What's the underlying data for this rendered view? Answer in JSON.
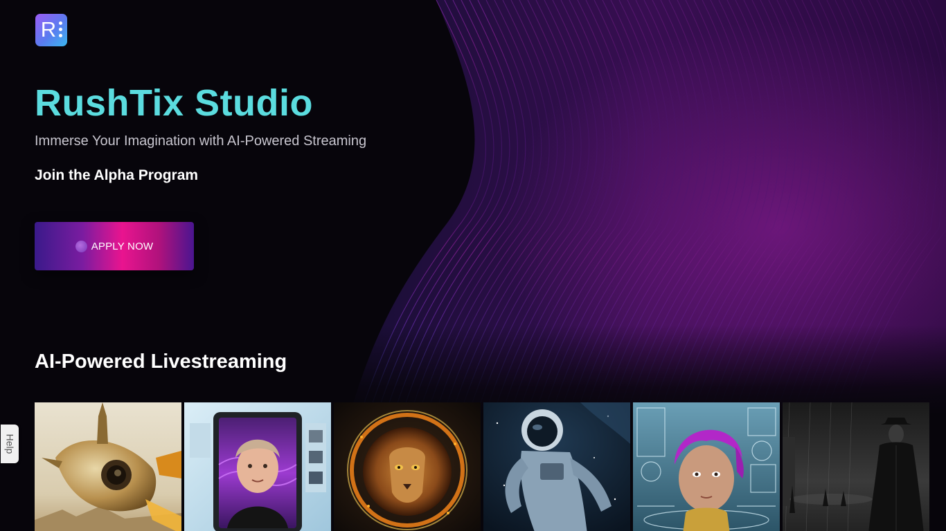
{
  "brand": {
    "logo_letter": "R",
    "title": "RushTix Studio",
    "subtitle": "Immerse Your Imagination with AI-Powered Streaming",
    "cta_heading": "Join the Alpha Program",
    "apply_label": "APPLY NOW"
  },
  "colors": {
    "title": "#5bdcdf",
    "accent_pink": "#e9148f",
    "accent_purple": "#7a1ca0",
    "background": "#07050b"
  },
  "section": {
    "title": "AI-Powered Livestreaming"
  },
  "cards": [
    {
      "name": "steampunk-rocket-image"
    },
    {
      "name": "ai-avatar-shopping-image"
    },
    {
      "name": "fire-lion-image"
    },
    {
      "name": "astronaut-image"
    },
    {
      "name": "purple-hair-avatar-image"
    },
    {
      "name": "noir-detective-image"
    }
  ],
  "help": {
    "label": "Help"
  }
}
